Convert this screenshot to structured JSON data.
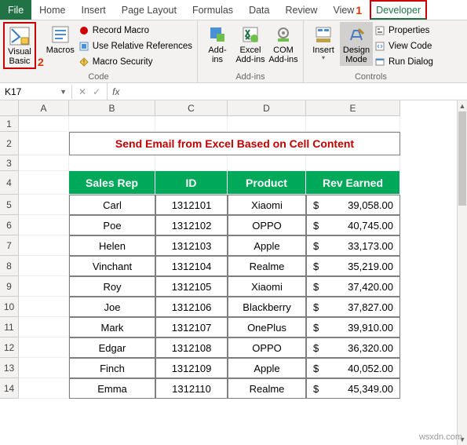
{
  "tabs": {
    "file": "File",
    "home": "Home",
    "insert": "Insert",
    "page_layout": "Page Layout",
    "formulas": "Formulas",
    "data": "Data",
    "review": "Review",
    "view": "View",
    "developer": "Developer",
    "step1": "1",
    "step2": "2"
  },
  "ribbon": {
    "code": {
      "visual_basic": "Visual\nBasic",
      "macros": "Macros",
      "record_macro": "Record Macro",
      "use_relative": "Use Relative References",
      "macro_security": "Macro Security",
      "group": "Code"
    },
    "addins": {
      "addins": "Add-\nins",
      "excel_addins": "Excel\nAdd-ins",
      "com_addins": "COM\nAdd-ins",
      "group": "Add-ins"
    },
    "controls": {
      "insert": "Insert",
      "design_mode": "Design\nMode",
      "properties": "Properties",
      "view_code": "View Code",
      "run_dialog": "Run Dialog",
      "group": "Controls"
    }
  },
  "namebox": {
    "value": "K17"
  },
  "fx_label": "fx",
  "columns": [
    "A",
    "B",
    "C",
    "D",
    "E"
  ],
  "row_nums": [
    "1",
    "2",
    "3",
    "4",
    "5",
    "6",
    "7",
    "8",
    "9",
    "10",
    "11",
    "12",
    "13",
    "14"
  ],
  "title": "Send Email from Excel Based on Cell Content",
  "headers": {
    "b": "Sales Rep",
    "c": "ID",
    "d": "Product",
    "e": "Rev Earned"
  },
  "rows": [
    {
      "rep": "Carl",
      "id": "1312101",
      "prod": "Xiaomi",
      "rev": "39,058.00"
    },
    {
      "rep": "Poe",
      "id": "1312102",
      "prod": "OPPO",
      "rev": "40,745.00"
    },
    {
      "rep": "Helen",
      "id": "1312103",
      "prod": "Apple",
      "rev": "33,173.00"
    },
    {
      "rep": "Vinchant",
      "id": "1312104",
      "prod": "Realme",
      "rev": "35,219.00"
    },
    {
      "rep": "Roy",
      "id": "1312105",
      "prod": "Xiaomi",
      "rev": "37,420.00"
    },
    {
      "rep": "Joe",
      "id": "1312106",
      "prod": "Blackberry",
      "rev": "37,827.00"
    },
    {
      "rep": "Mark",
      "id": "1312107",
      "prod": "OnePlus",
      "rev": "39,910.00"
    },
    {
      "rep": "Edgar",
      "id": "1312108",
      "prod": "OPPO",
      "rev": "36,320.00"
    },
    {
      "rep": "Finch",
      "id": "1312109",
      "prod": "Apple",
      "rev": "40,052.00"
    },
    {
      "rep": "Emma",
      "id": "1312110",
      "prod": "Realme",
      "rev": "45,349.00"
    }
  ],
  "currency": "$",
  "watermark": "wsxdn.com"
}
